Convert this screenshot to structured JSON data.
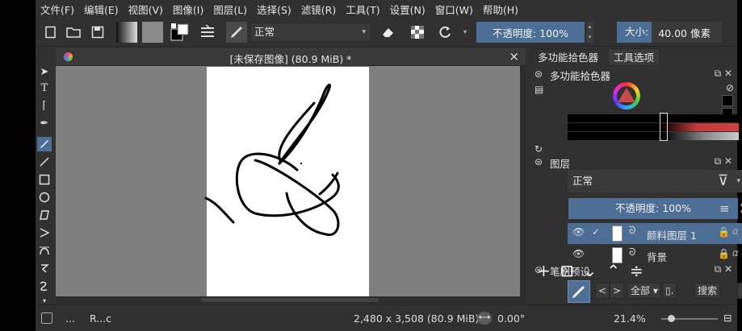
{
  "menubar": {
    "items": [
      "文件(F)",
      "编辑(E)",
      "视图(V)",
      "图像(I)",
      "图层(L)",
      "选择(S)",
      "滤镜(R)",
      "工具(T)",
      "设置(N)",
      "窗口(W)",
      "帮助(H)"
    ]
  },
  "toolbar": {
    "blend_mode": "正常",
    "opacity_label": "不透明度:  100%",
    "size_label": "大小:",
    "size_value": "40.00 像素"
  },
  "document": {
    "title": "[未保存图像] (80.9 MiB) *",
    "close": "×"
  },
  "dock": {
    "tabs": [
      "多功能拾色器",
      "工具选项"
    ],
    "color_panel_title": "多功能拾色器",
    "layers_panel_title": "图层",
    "layer_blend_mode": "正常",
    "layer_opacity": "不透明度:  100%",
    "layers": [
      {
        "name": "颜料图层 1",
        "selected": true
      },
      {
        "name": "背景",
        "selected": false
      }
    ],
    "brush_panel_title": "笔刷预设",
    "brush_filter": "全部",
    "brush_search": "搜索",
    "brush_only": "仅在"
  },
  "statusbar": {
    "ellipsis": "...",
    "brush_name": "R...c",
    "image_size": "2,480 x 3,508 (80.9 MiB)",
    "rotation": "0.00°",
    "zoom": "21.4%"
  },
  "colors": {
    "accent": "#4d6e95",
    "window_bg": "#313131",
    "canvas_bg": "#7f7f7f",
    "paper": "#ffffff",
    "stroke": "#000000"
  }
}
